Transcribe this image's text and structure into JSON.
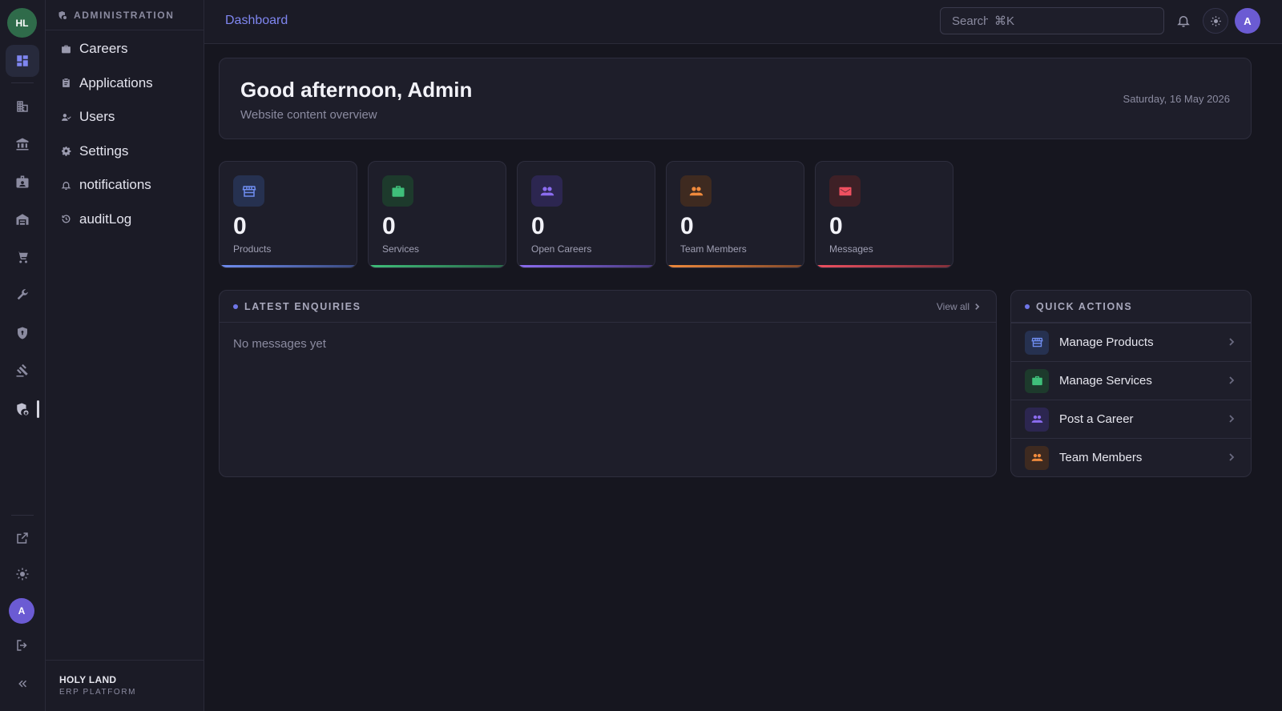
{
  "rail": {
    "logo_initials": "HL",
    "avatar_initial": "A"
  },
  "subnav": {
    "section_label": "ADMINISTRATION",
    "items": [
      {
        "label": "Careers",
        "icon": "briefcase-icon"
      },
      {
        "label": "Applications",
        "icon": "clipboard-icon"
      },
      {
        "label": "Users",
        "icon": "user-icon"
      },
      {
        "label": "Settings",
        "icon": "gear-icon"
      },
      {
        "label": "notifications",
        "icon": "bell-icon"
      },
      {
        "label": "auditLog",
        "icon": "history-icon"
      }
    ],
    "brand_name": "HOLY LAND",
    "brand_sub": "ERP PLATFORM"
  },
  "topbar": {
    "breadcrumb": "Dashboard",
    "search_placeholder": "Search",
    "search_shortcut": "⌘K",
    "avatar_initial": "A"
  },
  "hero": {
    "greeting": "Good afternoon, Admin",
    "subtitle": "Website content overview",
    "date": "Saturday, 16 May 2026"
  },
  "stats": [
    {
      "value": "0",
      "label": "Products",
      "color": "#6f8df0",
      "icon": "store-icon"
    },
    {
      "value": "0",
      "label": "Services",
      "color": "#3fbf7a",
      "icon": "briefcase-icon"
    },
    {
      "value": "0",
      "label": "Open Careers",
      "color": "#8b6cf0",
      "icon": "people-icon"
    },
    {
      "value": "0",
      "label": "Team Members",
      "color": "#f08a3c",
      "icon": "people-icon"
    },
    {
      "value": "0",
      "label": "Messages",
      "color": "#ef5060",
      "icon": "mail-icon"
    }
  ],
  "enquiries": {
    "title": "LATEST ENQUIRIES",
    "view_all": "View all",
    "empty_text": "No messages yet"
  },
  "quick_actions": {
    "title": "QUICK ACTIONS",
    "items": [
      {
        "label": "Manage Products",
        "color": "#6f8df0",
        "icon": "store-icon"
      },
      {
        "label": "Manage Services",
        "color": "#3fbf7a",
        "icon": "briefcase-icon"
      },
      {
        "label": "Post a Career",
        "color": "#8b6cf0",
        "icon": "people-icon"
      },
      {
        "label": "Team Members",
        "color": "#f08a3c",
        "icon": "people-icon"
      }
    ]
  }
}
